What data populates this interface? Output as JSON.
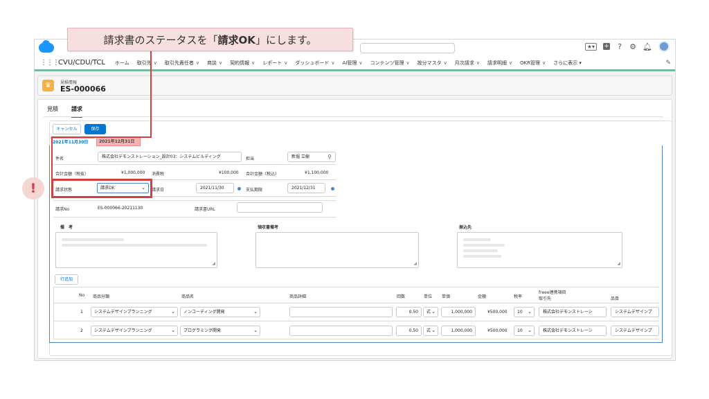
{
  "callout": {
    "prefix": "請求書のステータスを「",
    "bold": "請求OK",
    "suffix": "」にします。"
  },
  "alert_mark": "!",
  "nav": {
    "app_name": "CVU/CDU/TCL",
    "items": [
      "ホーム",
      "取引先",
      "取引先責任者",
      "商談",
      "契約情報",
      "レポート",
      "ダッシュボード",
      "AI管理",
      "コンテンツ管理",
      "按分マスタ",
      "月次請求",
      "請求明細",
      "OKR管理",
      "さらに表示"
    ],
    "chevron": "∨"
  },
  "record": {
    "type_label": "見積情報",
    "name": "ES-000066"
  },
  "tabs": [
    "見積",
    "請求"
  ],
  "buttons": {
    "cancel": "キャンセル",
    "save": "保存",
    "add_row": "行追加"
  },
  "date_tabs": [
    "2021年11月30日",
    "2021年12月31日"
  ],
  "fields": {
    "subject_label": "件名",
    "subject_value": "株式会社デモンストレーション_設計03：システムビルディング",
    "owner_label": "担当",
    "owner_value": "新堀 立樹",
    "total_ex_label": "合計金額（税抜）",
    "total_ex_value": "¥1,000,000",
    "tax_label": "消費税",
    "tax_value": "¥100,000",
    "total_in_label": "合計金額（税込）",
    "total_in_value": "¥1,100,000",
    "status_label": "請求状態",
    "status_value": "請求OK",
    "invoice_date_label": "請求日",
    "invoice_date_value": "2021/11/30",
    "due_label": "支払期限",
    "due_value": "2021/12/31",
    "invoice_no_label": "請求No",
    "invoice_no_value": "ES-000066-20211130",
    "invoice_url_label": "請求書URL",
    "invoice_url_value": ""
  },
  "sections": {
    "remarks": "備　考",
    "receipt_remarks": "領収書備考",
    "bank": "振込先"
  },
  "table": {
    "headers": {
      "no": "No",
      "category": "商品分類",
      "product": "商品名",
      "detail": "商品詳細",
      "count": "回数",
      "unit": "単位",
      "price": "単価",
      "amount": "金額",
      "tax": "税率",
      "freee_line1": "freee連携項目",
      "freee_line2": "取引先",
      "item": "品目"
    },
    "rows": [
      {
        "no": "1",
        "category": "システムデザインプランニング",
        "product": "ノンコーディング開発",
        "detail": "",
        "count": "0.50",
        "unit": "式",
        "price": "1,000,000",
        "amount": "¥500,000",
        "tax": "10",
        "partner": "株式会社デモンストレーシ",
        "item": "システムデザインプ"
      },
      {
        "no": "2",
        "category": "システムデザインプランニング",
        "product": "プログラミング開発",
        "detail": "",
        "count": "0.50",
        "unit": "式",
        "price": "1,000,000",
        "amount": "¥500,000",
        "tax": "10",
        "partner": "株式会社デモンストレーシ",
        "item": "システムデザインプ"
      }
    ]
  },
  "icons": {
    "search": "search-icon",
    "calendar": "calendar-icon",
    "waffle": "app-launcher-icon",
    "help": "?",
    "gear": "gear-icon",
    "bell": "bell-icon",
    "plus": "+",
    "star": "★",
    "pencil": "✎",
    "crown": "♛",
    "dropdown": "▾",
    "resize": "◢"
  },
  "colors": {
    "accent_blue": "#0176d3",
    "highlight_red": "#d33e3e",
    "callout_bg": "#f8dfdf",
    "nav_border": "#78b6a4",
    "date_tab_red": "#f5b5b5"
  }
}
